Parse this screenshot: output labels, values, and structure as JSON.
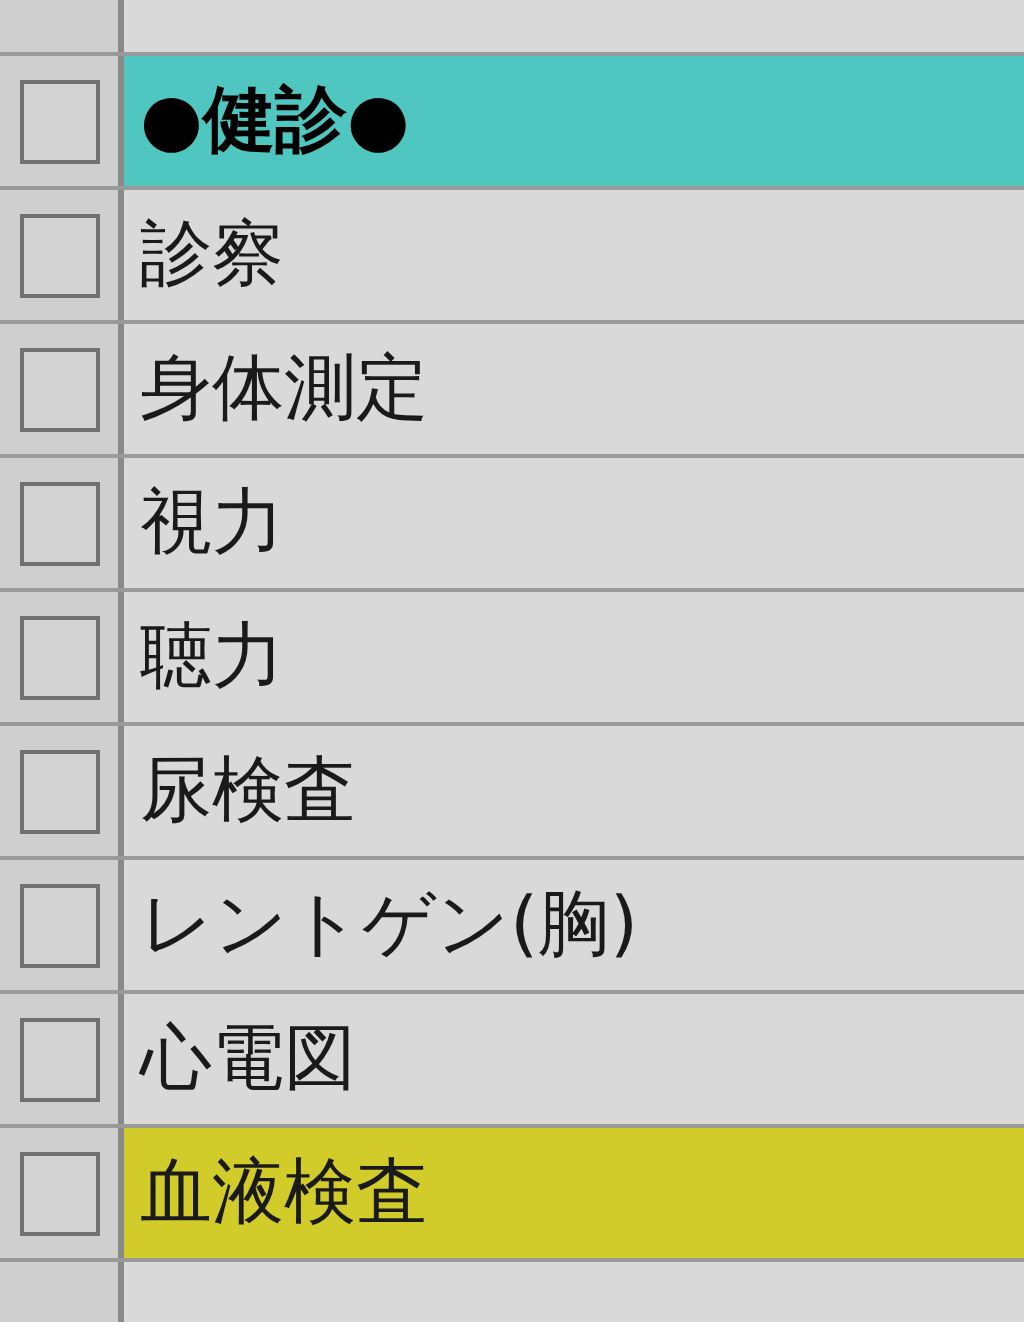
{
  "rows": [
    {
      "label": "●健診●",
      "bold": true,
      "checked": false,
      "color": "#4fc6c0"
    },
    {
      "label": "診察",
      "bold": false,
      "checked": false
    },
    {
      "label": "身体測定",
      "bold": false,
      "checked": false
    },
    {
      "label": "視力",
      "bold": false,
      "checked": false
    },
    {
      "label": "聴力",
      "bold": false,
      "checked": false
    },
    {
      "label": "尿検査",
      "bold": false,
      "checked": false
    },
    {
      "label": "レントゲン(胸)",
      "bold": false,
      "checked": false
    },
    {
      "label": "心電図",
      "bold": false,
      "checked": false
    },
    {
      "label": "血液検査",
      "bold": false,
      "checked": false,
      "color": "#d2cc2a"
    }
  ]
}
